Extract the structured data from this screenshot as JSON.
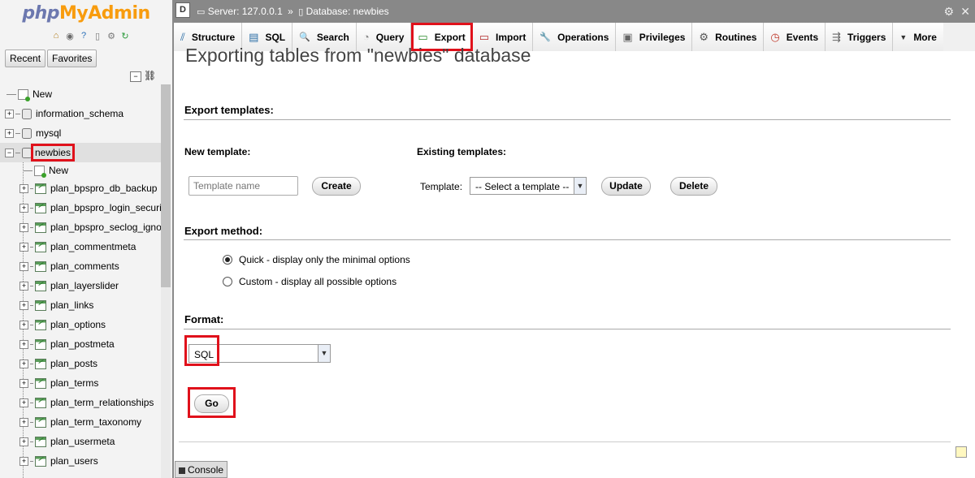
{
  "sidebar": {
    "logo": {
      "php": "php",
      "my": "My",
      "admin": "Admin"
    },
    "quick_icons": [
      "home-icon",
      "logout-icon",
      "help-icon",
      "docs-icon",
      "settings-icon",
      "reload-icon"
    ],
    "recent_label": "Recent",
    "favorites_label": "Favorites",
    "tree": [
      {
        "label": "New",
        "type": "new",
        "level": 0
      },
      {
        "label": "information_schema",
        "type": "db",
        "level": 0
      },
      {
        "label": "mysql",
        "type": "db",
        "level": 0
      },
      {
        "label": "newbies",
        "type": "db",
        "level": 0,
        "selected": true
      },
      {
        "label": "New",
        "type": "new",
        "level": 1
      },
      {
        "label": "plan_bpspro_db_backup",
        "type": "table",
        "level": 1
      },
      {
        "label": "plan_bpspro_login_security",
        "type": "table",
        "level": 1
      },
      {
        "label": "plan_bpspro_seclog_ignore",
        "type": "table",
        "level": 1
      },
      {
        "label": "plan_commentmeta",
        "type": "table",
        "level": 1
      },
      {
        "label": "plan_comments",
        "type": "table",
        "level": 1
      },
      {
        "label": "plan_layerslider",
        "type": "table",
        "level": 1
      },
      {
        "label": "plan_links",
        "type": "table",
        "level": 1
      },
      {
        "label": "plan_options",
        "type": "table",
        "level": 1
      },
      {
        "label": "plan_postmeta",
        "type": "table",
        "level": 1
      },
      {
        "label": "plan_posts",
        "type": "table",
        "level": 1
      },
      {
        "label": "plan_terms",
        "type": "table",
        "level": 1
      },
      {
        "label": "plan_term_relationships",
        "type": "table",
        "level": 1
      },
      {
        "label": "plan_term_taxonomy",
        "type": "table",
        "level": 1
      },
      {
        "label": "plan_usermeta",
        "type": "table",
        "level": 1
      },
      {
        "label": "plan_users",
        "type": "table",
        "level": 1
      }
    ]
  },
  "topbar": {
    "server": "Server: 127.0.0.1",
    "separator": "»",
    "database": "Database: newbies"
  },
  "tabs": [
    {
      "label": "Structure",
      "icon": "structure-icon",
      "glyph": "⫽"
    },
    {
      "label": "SQL",
      "icon": "sql-icon",
      "glyph": "▤"
    },
    {
      "label": "Search",
      "icon": "search-icon",
      "glyph": "🔍"
    },
    {
      "label": "Query",
      "icon": "query-icon",
      "glyph": "◔"
    },
    {
      "label": "Export",
      "icon": "export-icon",
      "glyph": "▭",
      "active": true
    },
    {
      "label": "Import",
      "icon": "import-icon",
      "glyph": "▭"
    },
    {
      "label": "Operations",
      "icon": "wrench-icon",
      "glyph": "🔧"
    },
    {
      "label": "Privileges",
      "icon": "privileges-icon",
      "glyph": "▣"
    },
    {
      "label": "Routines",
      "icon": "routines-icon",
      "glyph": "⚙"
    },
    {
      "label": "Events",
      "icon": "clock-icon",
      "glyph": "◷"
    },
    {
      "label": "Triggers",
      "icon": "triggers-icon",
      "glyph": "⇶"
    },
    {
      "label": "More",
      "icon": "more-icon",
      "glyph": "▼"
    }
  ],
  "main": {
    "page_title": "Exporting tables from \"newbies\" database",
    "export_templates_title": "Export templates:",
    "new_template_label": "New template:",
    "template_name_placeholder": "Template name",
    "create_button": "Create",
    "existing_templates_label": "Existing templates:",
    "template_label": "Template:",
    "template_select_value": "-- Select a template --",
    "update_button": "Update",
    "delete_button": "Delete",
    "export_method_title": "Export method:",
    "method_quick": "Quick - display only the minimal options",
    "method_custom": "Custom - display all possible options",
    "format_title": "Format:",
    "format_value": "SQL",
    "go_button": "Go",
    "console_label": "Console"
  },
  "colors": {
    "highlight_red": "#e0111b",
    "topbar_gray": "#888888",
    "logo_blue": "#6c78af",
    "logo_orange": "#f89c0e"
  }
}
